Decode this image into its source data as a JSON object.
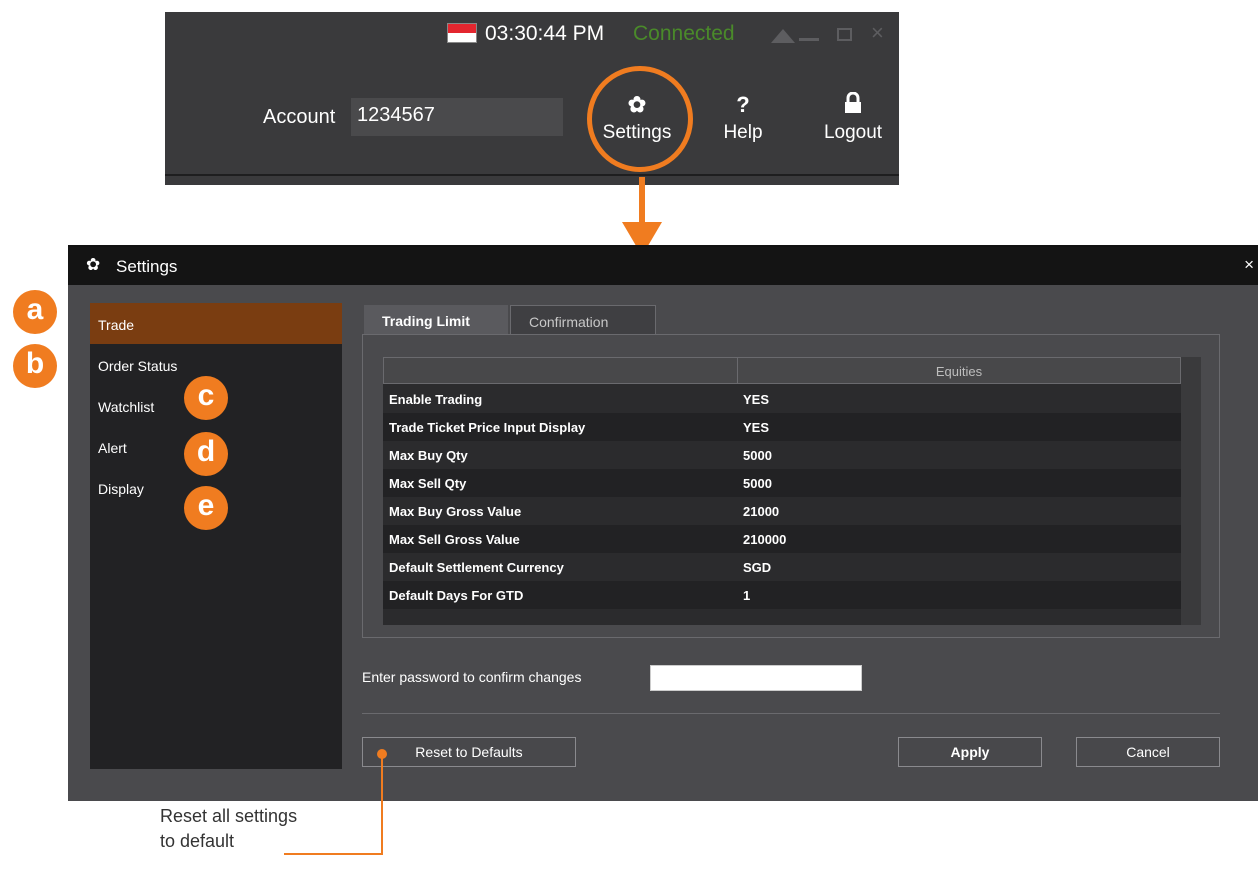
{
  "toolbar": {
    "time": "03:30:44 PM",
    "connection_status": "Connected",
    "account_label": "Account",
    "account_value": "1234567",
    "settings_label": "Settings",
    "help_label": "Help",
    "logout_label": "Logout"
  },
  "dialog": {
    "title": "Settings",
    "sidebar": {
      "items": [
        {
          "label": "Trade"
        },
        {
          "label": "Order Status"
        },
        {
          "label": "Watchlist"
        },
        {
          "label": "Alert"
        },
        {
          "label": "Display"
        }
      ]
    },
    "tabs": [
      {
        "label": "Trading Limit"
      },
      {
        "label": "Confirmation"
      }
    ],
    "grid": {
      "column_header": "Equities",
      "rows": [
        {
          "name": "Enable Trading",
          "value": "YES"
        },
        {
          "name": "Trade Ticket Price Input Display",
          "value": "YES"
        },
        {
          "name": "Max Buy Qty",
          "value": "5000"
        },
        {
          "name": "Max Sell Qty",
          "value": "5000"
        },
        {
          "name": "Max Buy Gross Value",
          "value": "21000"
        },
        {
          "name": "Max Sell Gross Value",
          "value": "210000"
        },
        {
          "name": "Default Settlement Currency",
          "value": "SGD"
        },
        {
          "name": "Default Days For GTD",
          "value": "1"
        }
      ]
    },
    "password_label": "Enter password to confirm changes",
    "buttons": {
      "reset": "Reset to Defaults",
      "apply": "Apply",
      "cancel": "Cancel"
    }
  },
  "callouts": {
    "a": "a",
    "b": "b",
    "c": "c",
    "d": "d",
    "e": "e"
  },
  "annotation": {
    "line1": "Reset all settings",
    "line2": "to default"
  },
  "colors": {
    "accent": "#f07c20",
    "connected": "#4a8a2a",
    "active_item": "#7a3d11"
  },
  "icons": {
    "flag": "singapore-flag-icon",
    "settings": "gear-icon",
    "help": "question-mark-icon",
    "logout": "lock-icon"
  }
}
